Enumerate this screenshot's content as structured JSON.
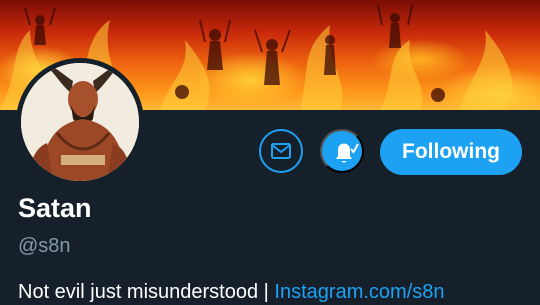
{
  "profile": {
    "display_name": "Satan",
    "handle": "@s8n",
    "bio_text": "Not evil just misunderstood | ",
    "bio_link": "Instagram.com/s8n"
  },
  "actions": {
    "message_icon": "envelope-icon",
    "notify_icon": "bell-check-icon",
    "follow_label": "Following"
  },
  "colors": {
    "accent": "#1da1f2",
    "background": "#15202b",
    "secondary_text": "#8899a6"
  }
}
